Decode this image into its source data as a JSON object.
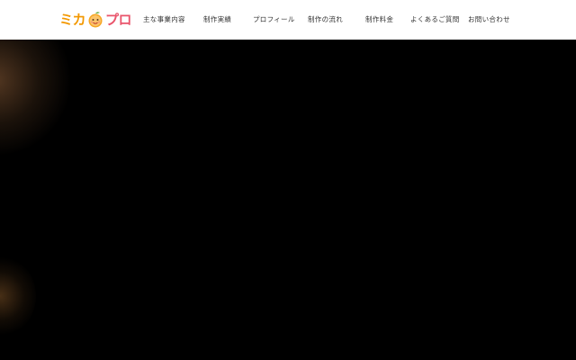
{
  "brand": {
    "logo_parts": [
      "ミカ",
      "プロ"
    ],
    "logo_icon": "orange-face-icon",
    "colors": {
      "orange": "#f39800",
      "pink": "#e9546b",
      "header_bg": "#ffffff",
      "hero_bg": "#000000"
    }
  },
  "nav": {
    "items": [
      {
        "label": "主な事業内容"
      },
      {
        "label": "制作実績"
      },
      {
        "label": "プロフィール"
      },
      {
        "label": "制作の流れ"
      },
      {
        "label": "制作料金"
      },
      {
        "label": "よくあるご質問"
      },
      {
        "label": "お問い合わせ"
      }
    ]
  }
}
